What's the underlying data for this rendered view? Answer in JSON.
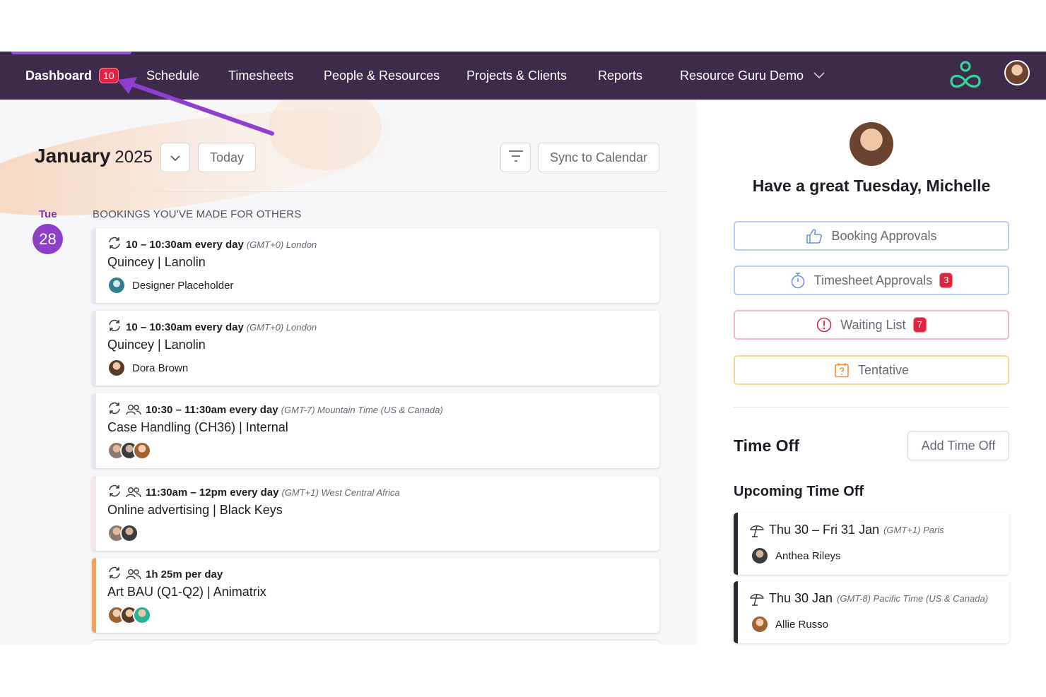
{
  "nav": {
    "items": [
      {
        "label": "Dashboard",
        "badge": "10"
      },
      {
        "label": "Schedule"
      },
      {
        "label": "Timesheets"
      },
      {
        "label": "People & Resources"
      },
      {
        "label": "Projects & Clients"
      },
      {
        "label": "Reports"
      }
    ],
    "account": "Resource Guru Demo",
    "logo_icon": "resource-guru-logo-icon",
    "avatar_icon": "user-avatar"
  },
  "calendar": {
    "month": "January",
    "year": "2025",
    "today_label": "Today",
    "sync_label": "Sync to Calendar",
    "day_name": "Tue",
    "day_number": "28"
  },
  "bookings": {
    "section_label": "BOOKINGS YOU'VE MADE FOR OTHERS",
    "items": [
      {
        "time": "10 – 10:30am every day",
        "tz": "(GMT+0) London",
        "title": "Quincey | Lanolin",
        "person": "Designer Placeholder",
        "accent": "#ece5f3"
      },
      {
        "time": "10 – 10:30am every day",
        "tz": "(GMT+0) London",
        "title": "Quincey | Lanolin",
        "person": "Dora Brown",
        "accent": "#ece5f3"
      },
      {
        "time": "10:30 – 11:30am every day",
        "tz": "(GMT-7) Mountain Time (US & Canada)",
        "title": "Case Handling (CH36) | Internal",
        "accent": "#ece5f3"
      },
      {
        "time": "11:30am – 12pm every day",
        "tz": "(GMT+1) West Central Africa",
        "title": "Online advertising | Black Keys",
        "accent": "#f9e4e6"
      },
      {
        "time": "1h 25m per day",
        "tz": "",
        "title": "Art BAU (Q1-Q2) | Animatrix",
        "accent": "#f5a15c"
      }
    ]
  },
  "panel": {
    "greeting": "Have a great Tuesday, Michelle",
    "buttons": [
      {
        "label": "Booking Approvals",
        "icon": "thumbs-up-icon",
        "color": "#b9cdf5"
      },
      {
        "label": "Timesheet Approvals",
        "badge": "3",
        "icon": "stopwatch-icon",
        "color": "#b9cdf5"
      },
      {
        "label": "Waiting List",
        "badge": "7",
        "icon": "alert-circle-icon",
        "color": "#f6b9c0"
      },
      {
        "label": "Tentative",
        "icon": "calendar-question-icon",
        "color": "#f8d79d"
      }
    ],
    "time_off_title": "Time Off",
    "add_time_off_label": "Add Time Off",
    "upcoming_title": "Upcoming Time Off",
    "time_off": [
      {
        "dates": "Thu 30 – Fri 31 Jan",
        "tz": "(GMT+1) Paris",
        "person": "Anthea Rileys"
      },
      {
        "dates": "Thu 30 Jan",
        "tz": "(GMT-8) Pacific Time (US & Canada)",
        "person": "Allie Russo"
      }
    ]
  }
}
